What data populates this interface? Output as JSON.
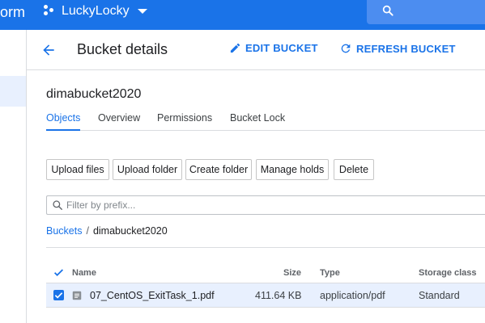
{
  "topbar": {
    "brand_tail": "orm",
    "project_name": "LuckyLocky",
    "colors": {
      "bar": "#1a73e8",
      "search": "#4c8df0"
    },
    "icons": [
      "project-icon",
      "chevron-down-icon",
      "search-icon"
    ]
  },
  "header": {
    "title": "Bucket details",
    "edit_label": "EDIT BUCKET",
    "refresh_label": "REFRESH BUCKET",
    "icons": [
      "arrow-back-icon",
      "pencil-icon",
      "refresh-icon"
    ]
  },
  "bucket": {
    "name": "dimabucket2020",
    "tabs": [
      "Objects",
      "Overview",
      "Permissions",
      "Bucket Lock"
    ],
    "active_tab": "Objects"
  },
  "toolbar": {
    "buttons": [
      "Upload files",
      "Upload folder",
      "Create folder",
      "Manage holds",
      "Delete"
    ]
  },
  "filter": {
    "placeholder": "Filter by prefix..."
  },
  "breadcrumb": {
    "root": "Buckets",
    "separator": "/",
    "current": "dimabucket2020"
  },
  "table": {
    "columns": [
      "Name",
      "Size",
      "Type",
      "Storage class"
    ],
    "rows": [
      {
        "name": "07_CentOS_ExitTask_1.pdf",
        "size": "411.64 KB",
        "type": "application/pdf",
        "storage_class": "Standard",
        "selected": true
      }
    ],
    "accent": "#1a73e8",
    "selected_row_bg": "#e8f0fe"
  }
}
